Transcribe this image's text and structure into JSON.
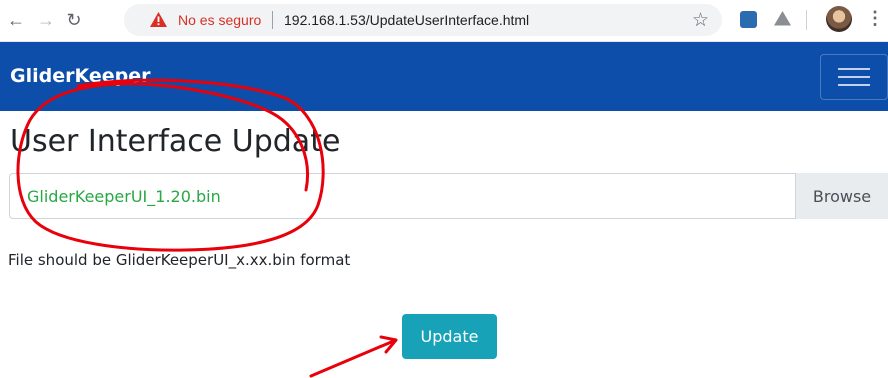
{
  "browser": {
    "security_label": "No es seguro",
    "url": "192.168.1.53/UpdateUserInterface.html",
    "icons": {
      "back": "arrow-left-icon",
      "forward": "arrow-right-icon",
      "reload": "reload-icon",
      "warning": "warning-triangle-icon",
      "bookmark": "star-icon",
      "menu": "kebab-menu-icon"
    },
    "colors": {
      "warning": "#d93025"
    }
  },
  "app": {
    "brand": "GliderKeeper",
    "navbar_color": "#0c4eaa",
    "menu_toggle": "hamburger-icon"
  },
  "main": {
    "title": "User Interface Update",
    "file_input": {
      "value": "GliderKeeperUI_1.20.bin",
      "value_color": "#28a745",
      "browse_label": "Browse"
    },
    "help_text": "File should be GliderKeeperUI_x.xx.bin format",
    "update_label": "Update",
    "update_color": "#17a2b8"
  },
  "annotations": {
    "color": "#e8000b",
    "items": [
      "hand-drawn-circle",
      "hand-drawn-arrow"
    ]
  }
}
